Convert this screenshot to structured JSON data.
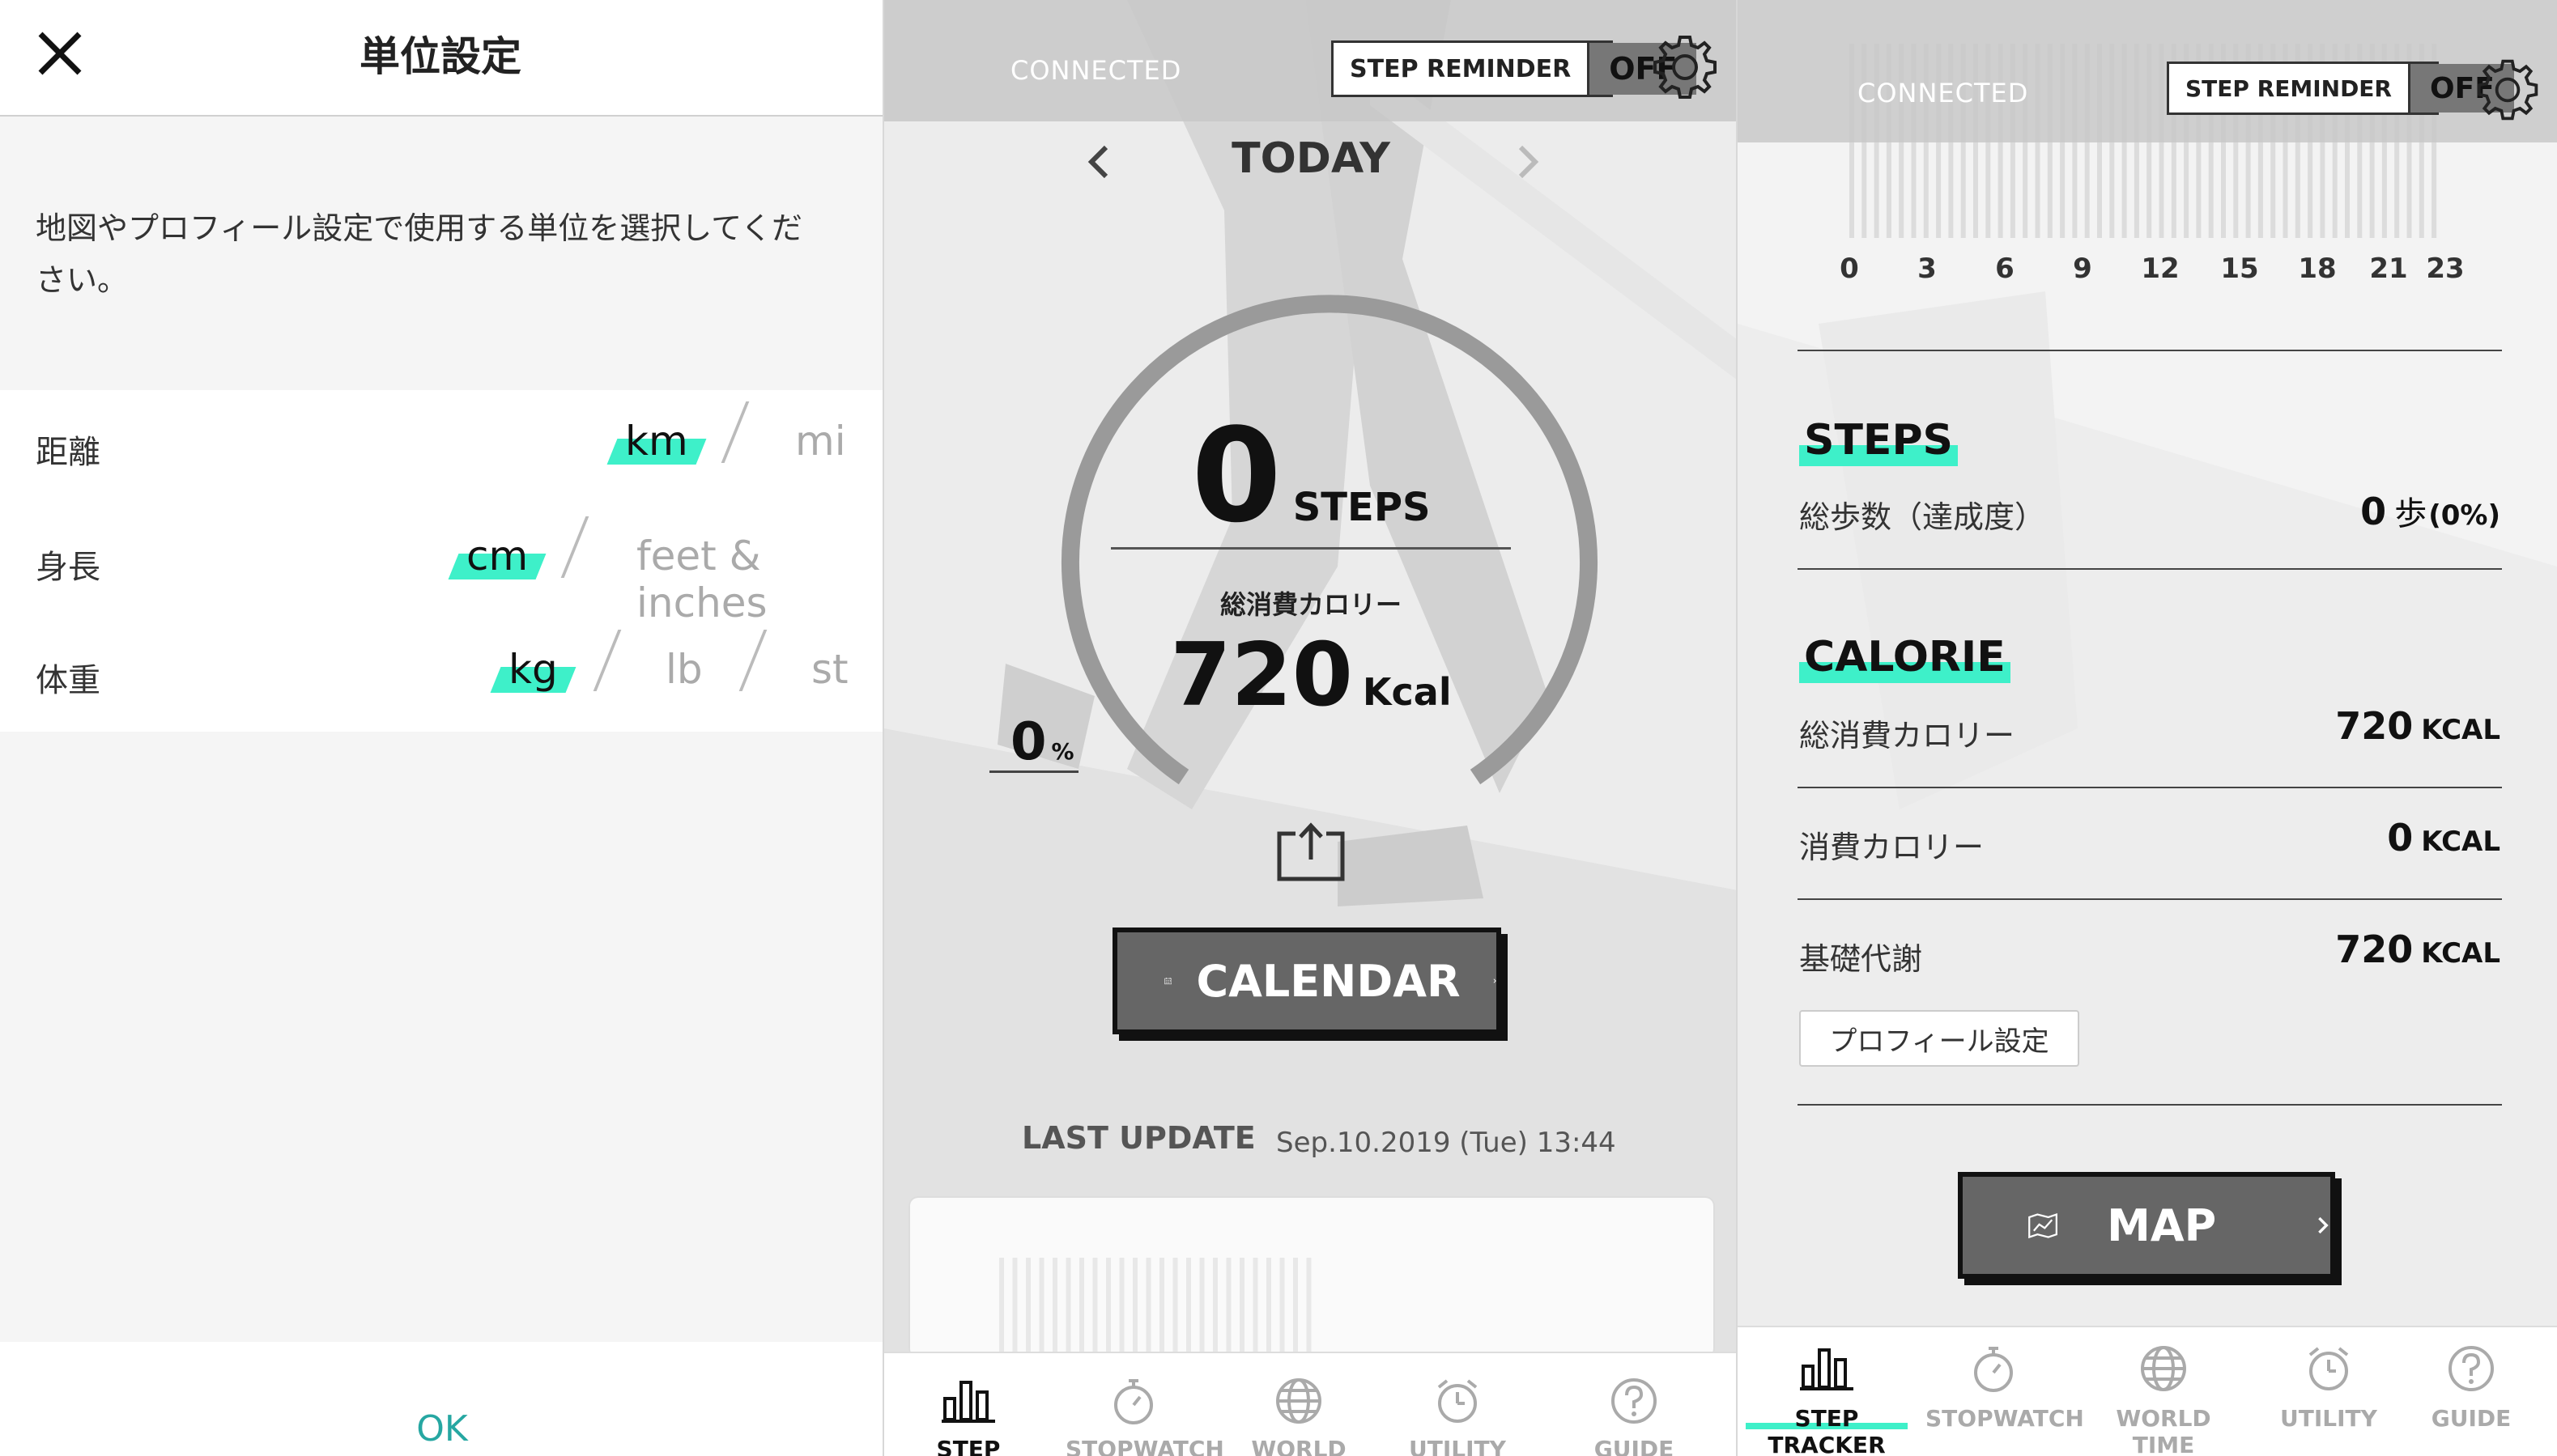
{
  "unit_settings": {
    "title": "単位設定",
    "description": "地図やプロフィール設定で使用する単位を選択してください。",
    "rows": [
      {
        "label": "距離",
        "options": [
          "km",
          "mi"
        ],
        "selected": "km"
      },
      {
        "label": "身長",
        "options": [
          "cm",
          "feet & inches"
        ],
        "selected": "cm"
      },
      {
        "label": "体重",
        "options": [
          "kg",
          "lb",
          "st"
        ],
        "selected": "kg"
      }
    ],
    "ok_label": "OK"
  },
  "status": {
    "connected": "CONNECTED",
    "step_reminder_label": "STEP REMINDER",
    "step_reminder_state": "OFF"
  },
  "tracker": {
    "day_label": "TODAY",
    "steps_value": "0",
    "steps_unit": "STEPS",
    "calorie_label": "総消費カロリー",
    "calorie_value": "720",
    "calorie_unit": "Kcal",
    "percent_value": "0",
    "percent_unit": "%",
    "calendar_label": "CALENDAR",
    "last_update_label": "LAST UPDATE",
    "last_update_value": "Sep.10.2019 (Tue) 13:44"
  },
  "detail": {
    "hours": [
      "0",
      "3",
      "6",
      "9",
      "12",
      "15",
      "18",
      "21",
      "23"
    ],
    "steps_title": "STEPS",
    "steps_row_label": "総歩数（達成度）",
    "steps_row_value": "0",
    "steps_row_unit": "歩",
    "steps_row_pct": "(0%)",
    "calorie_title": "CALORIE",
    "rows": [
      {
        "label": "総消費カロリー",
        "value": "720",
        "unit": "KCAL"
      },
      {
        "label": "消費カロリー",
        "value": "0",
        "unit": "KCAL"
      },
      {
        "label": "基礎代謝",
        "value": "720",
        "unit": "KCAL"
      }
    ],
    "profile_button": "プロフィール設定",
    "map_label": "MAP"
  },
  "tabs": [
    {
      "label": "STEP TRACKER",
      "icon": "bar-chart-icon",
      "active": true
    },
    {
      "label": "STOPWATCH",
      "icon": "stopwatch-icon",
      "active": false
    },
    {
      "label": "WORLD TIME",
      "icon": "globe-icon",
      "active": false
    },
    {
      "label": "UTILITY",
      "icon": "alarm-clock-icon",
      "active": false
    },
    {
      "label": "GUIDE",
      "icon": "question-icon",
      "active": false
    }
  ],
  "colors": {
    "accent": "#3ef0c9",
    "ok_text": "#26a7a2",
    "button_fill": "#666666"
  }
}
